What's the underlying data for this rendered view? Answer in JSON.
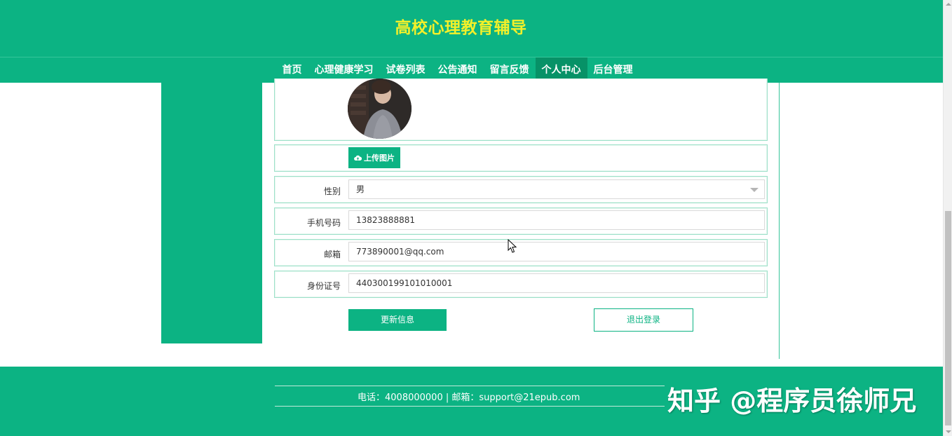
{
  "header": {
    "title": "高校心理教育辅导"
  },
  "nav": {
    "items": [
      {
        "label": "首页"
      },
      {
        "label": "心理健康学习"
      },
      {
        "label": "试卷列表"
      },
      {
        "label": "公告通知"
      },
      {
        "label": "留言反馈"
      },
      {
        "label": "个人中心"
      },
      {
        "label": "后台管理"
      }
    ],
    "active_index": 5
  },
  "form": {
    "upload_label": "上传图片",
    "gender": {
      "label": "性别",
      "value": "男"
    },
    "phone": {
      "label": "手机号码",
      "value": "13823888881"
    },
    "email": {
      "label": "邮箱",
      "value": "773890001@qq.com"
    },
    "id_number": {
      "label": "身份证号",
      "value": "440300199101010001"
    },
    "update_button": "更新信息",
    "logout_button": "退出登录"
  },
  "footer": {
    "contact": "电话：4008000000 | 邮箱：support@21epub.com",
    "watermark": "知乎 @程序员徐师兄"
  },
  "colors": {
    "primary": "#0cb383",
    "active_nav": "#079267",
    "title": "#f2f02a"
  },
  "icons": {
    "upload": "cloud-upload-icon",
    "select": "chevron-down-icon"
  }
}
